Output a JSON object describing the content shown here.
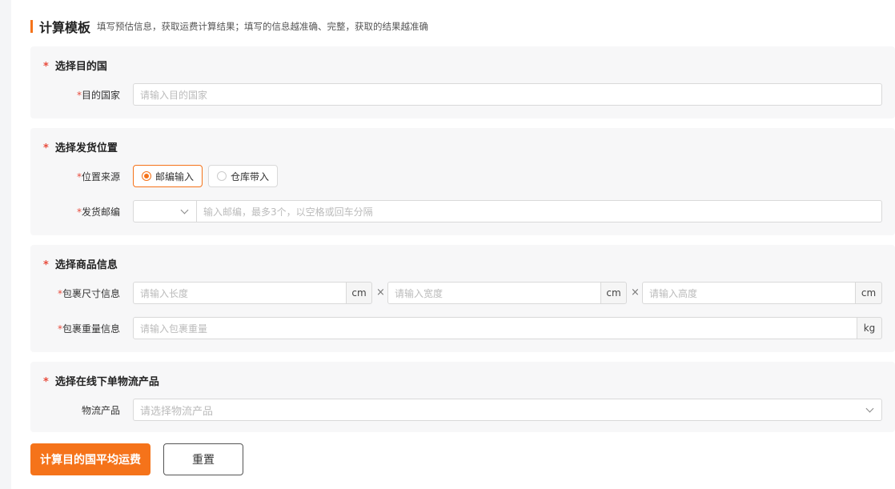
{
  "header": {
    "title": "计算模板",
    "subtitle": "填写预估信息，获取运费计算结果；填写的信息越准确、完整，获取的结果越准确"
  },
  "section_country": {
    "title": "选择目的国",
    "field_label": "目的国家",
    "placeholder": "请输入目的国家"
  },
  "section_origin": {
    "title": "选择发货位置",
    "source_label": "位置来源",
    "options": [
      "邮编输入",
      "仓库带入"
    ],
    "selected": "邮编输入",
    "zip_label": "发货邮编",
    "zip_prefix_value": "",
    "zip_placeholder": "输入邮编，最多3个，以空格或回车分隔"
  },
  "section_goods": {
    "title": "选择商品信息",
    "size_label": "包裹尺寸信息",
    "length_placeholder": "请输入长度",
    "width_placeholder": "请输入宽度",
    "height_placeholder": "请输入高度",
    "size_unit": "cm",
    "times": "×",
    "weight_label": "包裹重量信息",
    "weight_placeholder": "请输入包裹重量",
    "weight_unit": "kg"
  },
  "section_logistics": {
    "title": "选择在线下单物流产品",
    "field_label": "物流产品",
    "placeholder": "请选择物流产品"
  },
  "actions": {
    "calculate_label": "计算目的国平均运费",
    "reset_label": "重置"
  },
  "colors": {
    "accent": "#f5731a",
    "required": "#e84c3d"
  }
}
